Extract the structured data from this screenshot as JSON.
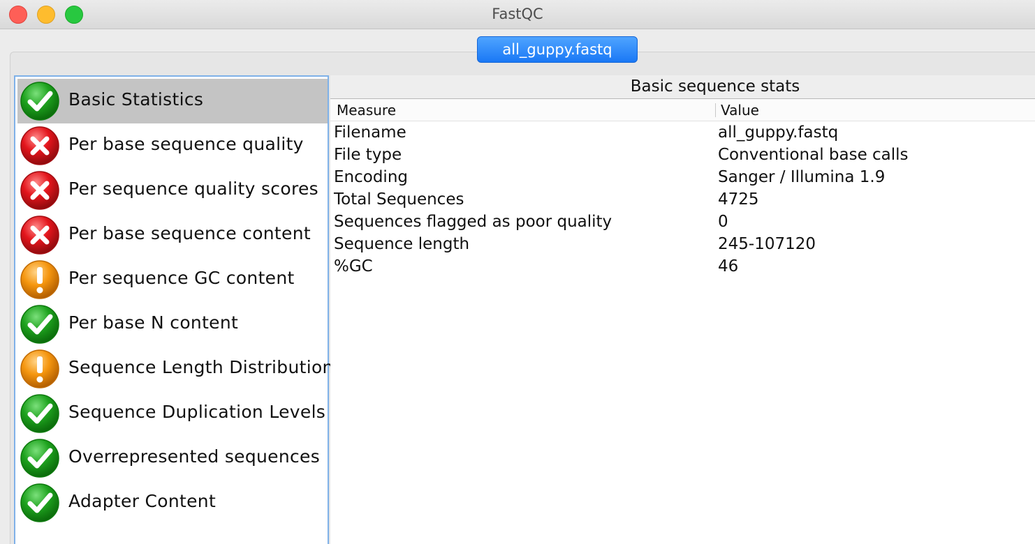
{
  "window": {
    "title": "FastQC"
  },
  "tab": {
    "label": "all_guppy.fastq"
  },
  "modules": [
    {
      "label": "Basic Statistics",
      "status": "pass",
      "icon": "check-icon",
      "selected": true
    },
    {
      "label": "Per base sequence quality",
      "status": "fail",
      "icon": "cross-icon"
    },
    {
      "label": "Per sequence quality scores",
      "status": "fail",
      "icon": "cross-icon"
    },
    {
      "label": "Per base sequence content",
      "status": "fail",
      "icon": "cross-icon"
    },
    {
      "label": "Per sequence GC content",
      "status": "warn",
      "icon": "warning-icon"
    },
    {
      "label": "Per base N content",
      "status": "pass",
      "icon": "check-icon"
    },
    {
      "label": "Sequence Length Distribution",
      "status": "warn",
      "icon": "warning-icon"
    },
    {
      "label": "Sequence Duplication Levels",
      "status": "pass",
      "icon": "check-icon"
    },
    {
      "label": "Overrepresented sequences",
      "status": "pass",
      "icon": "check-icon"
    },
    {
      "label": "Adapter Content",
      "status": "pass",
      "icon": "check-icon"
    }
  ],
  "stats": {
    "title": "Basic sequence stats",
    "columns": [
      "Measure",
      "Value"
    ],
    "rows": [
      {
        "measure": "Filename",
        "value": "all_guppy.fastq"
      },
      {
        "measure": "File type",
        "value": "Conventional base calls"
      },
      {
        "measure": "Encoding",
        "value": "Sanger / Illumina 1.9"
      },
      {
        "measure": "Total Sequences",
        "value": "4725"
      },
      {
        "measure": "Sequences flagged as poor quality",
        "value": "0"
      },
      {
        "measure": "Sequence length",
        "value": "245-107120"
      },
      {
        "measure": "%GC",
        "value": "46"
      }
    ]
  },
  "colors": {
    "pass": "#1ea21e",
    "fail": "#e3151c",
    "warn": "#f5960f",
    "tab_accent": "#1a78f5"
  }
}
